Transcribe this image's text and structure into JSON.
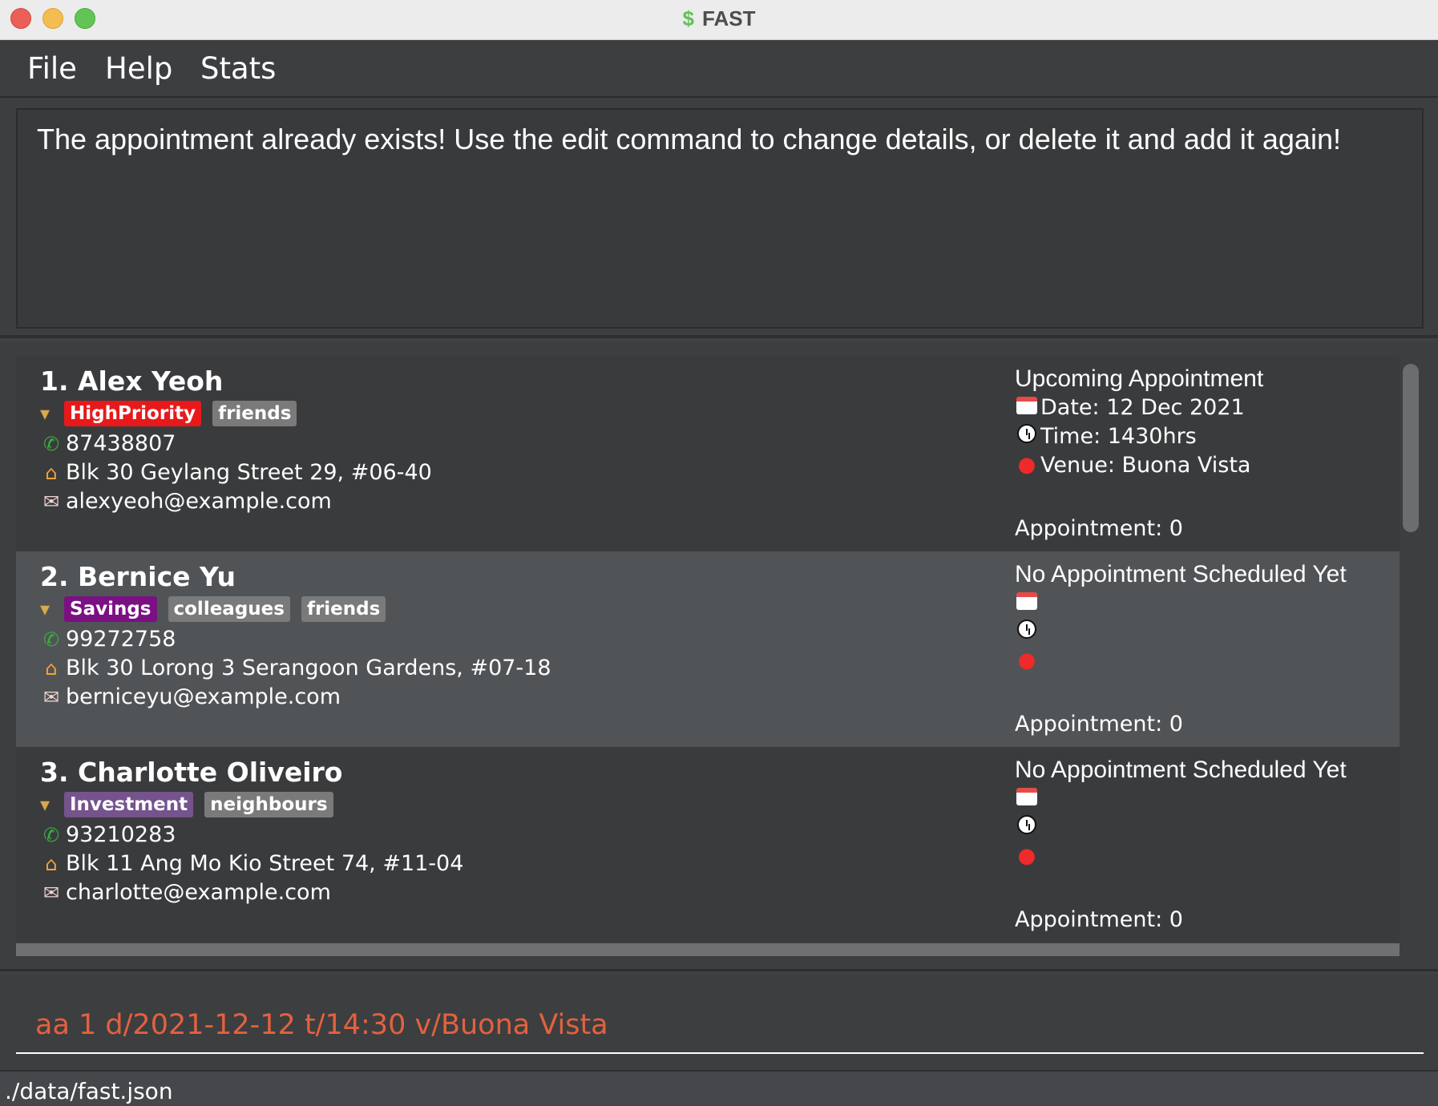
{
  "window": {
    "title": "FAST",
    "title_icon": "$"
  },
  "menu": {
    "file": "File",
    "help": "Help",
    "stats": "Stats"
  },
  "result": {
    "message": "The appointment already exists! Use the edit command to change details, or delete it and add it again!"
  },
  "persons": [
    {
      "index_name": "1.  Alex Yeoh",
      "tags": [
        {
          "label": "HighPriority",
          "color": "#e8191a"
        },
        {
          "label": "friends",
          "color": "#7a7a7a"
        }
      ],
      "phone": "87438807",
      "address": "Blk 30 Geylang Street 29, #06-40",
      "email": "alexyeoh@example.com",
      "appt_title": "Upcoming Appointment",
      "date": "Date: 12 Dec 2021",
      "time": "Time: 1430hrs",
      "venue": "Venue: Buona Vista",
      "count": "Appointment: 0"
    },
    {
      "index_name": "2.  Bernice Yu",
      "tags": [
        {
          "label": "Savings",
          "color": "#7b1083"
        },
        {
          "label": "colleagues",
          "color": "#7a7a7a"
        },
        {
          "label": "friends",
          "color": "#7a7a7a"
        }
      ],
      "phone": "99272758",
      "address": "Blk 30 Lorong 3 Serangoon Gardens, #07-18",
      "email": "berniceyu@example.com",
      "appt_title": "No Appointment Scheduled Yet",
      "date": "",
      "time": "",
      "venue": "",
      "count": "Appointment: 0"
    },
    {
      "index_name": "3.  Charlotte Oliveiro",
      "tags": [
        {
          "label": "Investment",
          "color": "#75538c"
        },
        {
          "label": "neighbours",
          "color": "#7a7a7a"
        }
      ],
      "phone": "93210283",
      "address": "Blk 11 Ang Mo Kio Street 74, #11-04",
      "email": "charlotte@example.com",
      "appt_title": "No Appointment Scheduled Yet",
      "date": "",
      "time": "",
      "venue": "",
      "count": "Appointment: 0"
    }
  ],
  "command": {
    "value": "aa 1 d/2021-12-12 t/14:30 v/Buona Vista"
  },
  "status": {
    "path": "./data/fast.json"
  },
  "icons": {
    "tag": "tag-icon",
    "phone": "phone-icon",
    "address": "house-icon",
    "email": "mail-icon",
    "date": "calendar-icon",
    "time": "clock-icon",
    "venue": "location-pin-icon"
  }
}
